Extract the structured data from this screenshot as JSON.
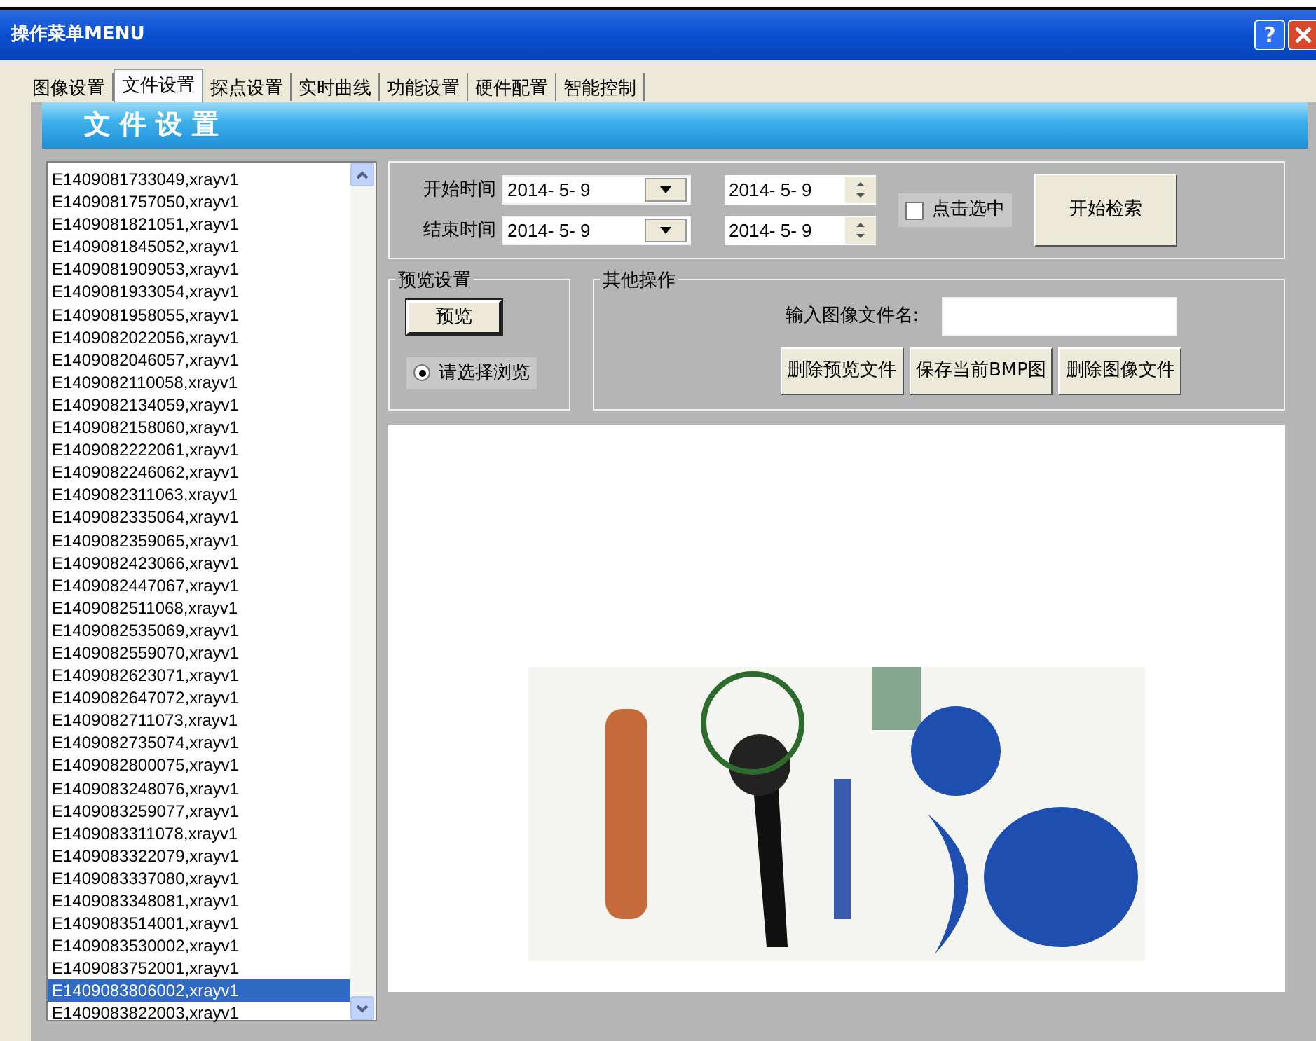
{
  "window": {
    "title": "操作菜单MENU",
    "help_button": "?"
  },
  "tabs": [
    {
      "label": "图像设置",
      "selected": false
    },
    {
      "label": "文件设置",
      "selected": true
    },
    {
      "label": "探点设置",
      "selected": false
    },
    {
      "label": "实时曲线",
      "selected": false
    },
    {
      "label": "功能设置",
      "selected": false
    },
    {
      "label": "硬件配置",
      "selected": false
    },
    {
      "label": "智能控制",
      "selected": false
    }
  ],
  "header": "文 件 设 置",
  "files": [
    {
      "name": "E1409081733049,xrayv1",
      "selected": false
    },
    {
      "name": "E1409081757050,xrayv1",
      "selected": false
    },
    {
      "name": "E1409081821051,xrayv1",
      "selected": false
    },
    {
      "name": "E1409081845052,xrayv1",
      "selected": false
    },
    {
      "name": "E1409081909053,xrayv1",
      "selected": false
    },
    {
      "name": "E1409081933054,xrayv1",
      "selected": false
    },
    {
      "name": "E1409081958055,xrayv1",
      "selected": false
    },
    {
      "name": "E1409082022056,xrayv1",
      "selected": false
    },
    {
      "name": "E1409082046057,xrayv1",
      "selected": false
    },
    {
      "name": "E1409082110058,xrayv1",
      "selected": false
    },
    {
      "name": "E1409082134059,xrayv1",
      "selected": false
    },
    {
      "name": "E1409082158060,xrayv1",
      "selected": false
    },
    {
      "name": "E1409082222061,xrayv1",
      "selected": false
    },
    {
      "name": "E1409082246062,xrayv1",
      "selected": false
    },
    {
      "name": "E1409082311063,xrayv1",
      "selected": false
    },
    {
      "name": "E1409082335064,xrayv1",
      "selected": false
    },
    {
      "name": "E1409082359065,xrayv1",
      "selected": false
    },
    {
      "name": "E1409082423066,xrayv1",
      "selected": false
    },
    {
      "name": "E1409082447067,xrayv1",
      "selected": false
    },
    {
      "name": "E1409082511068,xrayv1",
      "selected": false
    },
    {
      "name": "E1409082535069,xrayv1",
      "selected": false
    },
    {
      "name": "E1409082559070,xrayv1",
      "selected": false
    },
    {
      "name": "E1409082623071,xrayv1",
      "selected": false
    },
    {
      "name": "E1409082647072,xrayv1",
      "selected": false
    },
    {
      "name": "E1409082711073,xrayv1",
      "selected": false
    },
    {
      "name": "E1409082735074,xrayv1",
      "selected": false
    },
    {
      "name": "E1409082800075,xrayv1",
      "selected": false
    },
    {
      "name": "E1409083248076,xrayv1",
      "selected": false
    },
    {
      "name": "E1409083259077,xrayv1",
      "selected": false
    },
    {
      "name": "E1409083311078,xrayv1",
      "selected": false
    },
    {
      "name": "E1409083322079,xrayv1",
      "selected": false
    },
    {
      "name": "E1409083337080,xrayv1",
      "selected": false
    },
    {
      "name": "E1409083348081,xrayv1",
      "selected": false
    },
    {
      "name": "E1409083514001,xrayv1",
      "selected": false
    },
    {
      "name": "E1409083530002,xrayv1",
      "selected": false
    },
    {
      "name": "E1409083752001,xrayv1",
      "selected": false
    },
    {
      "name": "E1409083806002,xrayv1",
      "selected": true
    },
    {
      "name": "E1409083822003,xrayv1",
      "selected": false
    }
  ],
  "search": {
    "start_label": "开始时间",
    "start_date": "2014- 5- 9",
    "start_time": "2014- 5- 9",
    "end_label": "结束时间",
    "end_date": "2014- 5- 9",
    "end_time": "2014- 5- 9",
    "checkbox": {
      "label": "点击选中",
      "checked": false
    },
    "search_button": "开始检索"
  },
  "preview": {
    "title": "预览设置",
    "button": "预览",
    "radio": {
      "label": "请选择浏览",
      "selected": true
    }
  },
  "other": {
    "title": "其他操作",
    "filename_label": "输入图像文件名:",
    "buttons": [
      "删除预览文件",
      "保存当前BMP图",
      "删除图像文件"
    ]
  }
}
